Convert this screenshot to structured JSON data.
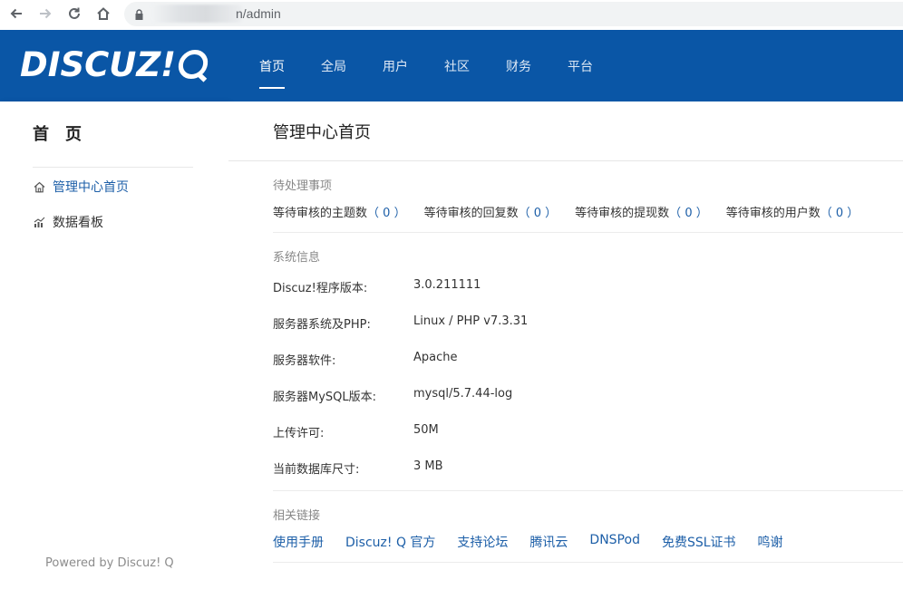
{
  "browser": {
    "url_suffix": "n/admin"
  },
  "header": {
    "logo_text": "DISCUZ!",
    "nav": [
      {
        "label": "首页"
      },
      {
        "label": "全局"
      },
      {
        "label": "用户"
      },
      {
        "label": "社区"
      },
      {
        "label": "财务"
      },
      {
        "label": "平台"
      }
    ],
    "active_index": 0
  },
  "sidebar": {
    "title": "首页",
    "items": [
      {
        "label": "管理中心首页",
        "icon": "home-icon"
      },
      {
        "label": "数据看板",
        "icon": "chart-icon"
      }
    ],
    "footer": "Powered by Discuz! Q"
  },
  "main": {
    "title": "管理中心首页",
    "pending": {
      "label": "待处理事项",
      "items": [
        {
          "label": "等待审核的主题数",
          "open": "（ ",
          "count": "0",
          "close": " ）"
        },
        {
          "label": "等待审核的回复数",
          "open": "（ ",
          "count": "0",
          "close": " ）"
        },
        {
          "label": "等待审核的提现数",
          "open": "（ ",
          "count": "0",
          "close": " ）"
        },
        {
          "label": "等待审核的用户数",
          "open": "（ ",
          "count": "0",
          "close": " ）"
        }
      ]
    },
    "sysinfo": {
      "label": "系统信息",
      "rows": [
        {
          "key": "Discuz!程序版本:",
          "value": "3.0.211111"
        },
        {
          "key": "服务器系统及PHP:",
          "value": "Linux / PHP v7.3.31"
        },
        {
          "key": "服务器软件:",
          "value": "Apache"
        },
        {
          "key": "服务器MySQL版本:",
          "value": "mysql/5.7.44-log"
        },
        {
          "key": "上传许可:",
          "value": "50M"
        },
        {
          "key": "当前数据库尺寸:",
          "value": "3 MB"
        }
      ]
    },
    "links": {
      "label": "相关链接",
      "items": [
        "使用手册",
        "Discuz! Q 官方",
        "支持论坛",
        "腾讯云",
        "DNSPod",
        "免费SSL证书",
        "鸣谢"
      ]
    }
  },
  "colors": {
    "brand_blue": "#0a56a6",
    "link_blue": "#1d5fa8"
  }
}
